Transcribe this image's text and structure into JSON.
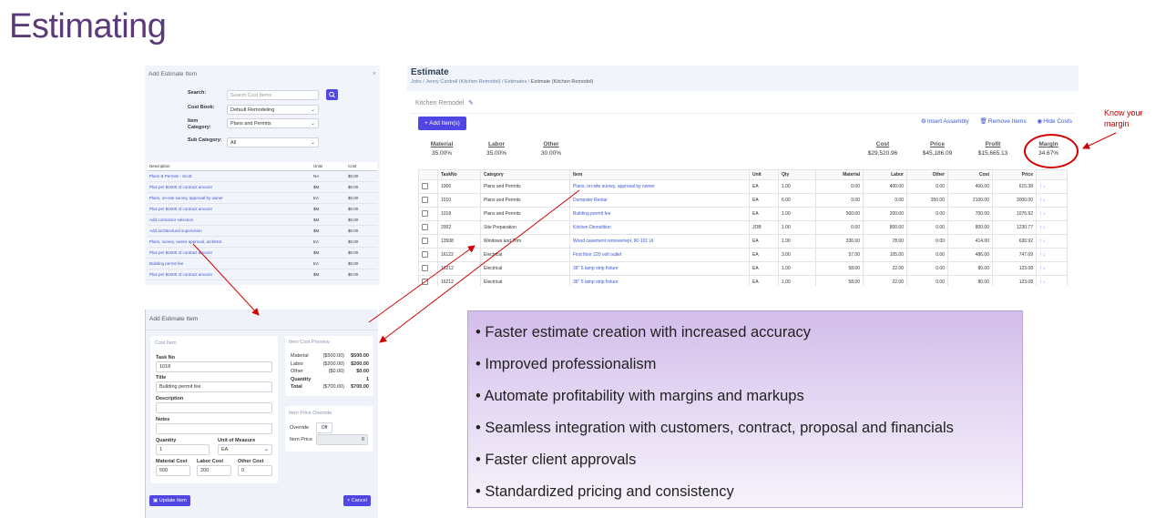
{
  "slide": {
    "title": "Estimating"
  },
  "add_item_search": {
    "title": "Add Estimate Item",
    "close": "×",
    "search_label": "Search:",
    "search_placeholder": "Search Cost Items",
    "cost_book_label": "Cost Book:",
    "cost_book_value": "Default Remodeling",
    "item_category_label": "Item Category:",
    "item_category_value": "Plans and Permits",
    "sub_category_label": "Sub Category:",
    "sub_category_value": "All",
    "columns": [
      "Description",
      "Units",
      "Cost"
    ],
    "rows": [
      [
        "Plans & Permits - Scott",
        "NA",
        "$0.00"
      ],
      [
        "Plus per $1000 of contract amount",
        "$M",
        "$0.00"
      ],
      [
        "Plans, on-site survey, approval by owner",
        "EA",
        "$0.00"
      ],
      [
        "Plus per $1000 of contract amount",
        "$M",
        "$0.00"
      ],
      [
        "Add contractor selection",
        "$M",
        "$0.00"
      ],
      [
        "Add architectural supervision",
        "$M",
        "$0.00"
      ],
      [
        "Plans, survey, owner approval, architect",
        "EA",
        "$0.00"
      ],
      [
        "Plus per $1000 of contract amount",
        "$M",
        "$0.00"
      ],
      [
        "Building permit fee",
        "EA",
        "$0.00"
      ],
      [
        "Plus per $1000 of contract amount",
        "$M",
        "$0.00"
      ]
    ]
  },
  "estimate": {
    "title": "Estimate",
    "breadcrumb": [
      "Jobs",
      "Jenny Cantrell (Kitchen Remodel)",
      "Estimates"
    ],
    "breadcrumb_current": "Estimate (Kitchen Remodel)",
    "job_name": "Kitchen Remodel",
    "add_button": "+ Add Item(s)",
    "toolbar": [
      "Insert Assembly",
      "Remove Items",
      "Hide Costs"
    ],
    "summary_left": [
      {
        "label": "Material",
        "value": "35.00%"
      },
      {
        "label": "Labor",
        "value": "35.00%"
      },
      {
        "label": "Other",
        "value": "30.00%"
      }
    ],
    "summary_right": [
      {
        "label": "Cost",
        "value": "$29,520.96"
      },
      {
        "label": "Price",
        "value": "$45,186.09"
      },
      {
        "label": "Profit",
        "value": "$15,665.13"
      },
      {
        "label": "Margin",
        "value": "34.67%"
      }
    ],
    "columns": [
      "TaskNo",
      "Category",
      "Item",
      "Unit",
      "Qty",
      "Material",
      "Labor",
      "Other",
      "Cost",
      "Price"
    ],
    "rows": [
      [
        "1006",
        "Plans and Permits",
        "Plans, on-site survey, approval by owner",
        "EA",
        "1.00",
        "0.00",
        "400.00",
        "0.00",
        "400.00",
        "615.38"
      ],
      [
        "1010",
        "Plans and Permits",
        "Dumpster Rental",
        "EA",
        "6.00",
        "0.00",
        "0.00",
        "350.00",
        "2100.00",
        "3000.00"
      ],
      [
        "1018",
        "Plans and Permits",
        "Building permit fee",
        "EA",
        "1.00",
        "500.00",
        "200.00",
        "0.00",
        "700.00",
        "1076.92"
      ],
      [
        "2002",
        "Site Preparation",
        "Kitchen Demolition",
        "JOB",
        "1.00",
        "0.00",
        "800.00",
        "0.00",
        "800.00",
        "1230.77"
      ],
      [
        "13508",
        "Windows and Trim",
        "Wood casement remove/repl, 90-101 UI",
        "EA",
        "1.00",
        "336.00",
        "78.00",
        "0.00",
        "414.00",
        "636.92"
      ],
      [
        "16122",
        "Electrical",
        "First floor 220 volt outlet",
        "EA",
        "3.00",
        "57.00",
        "105.00",
        "0.00",
        "486.00",
        "747.69"
      ],
      [
        "16212",
        "Electrical",
        "36\" 5 lamp strip fixture",
        "EA",
        "1.00",
        "58.00",
        "22.00",
        "0.00",
        "80.00",
        "123.08"
      ],
      [
        "16212",
        "Electrical",
        "36\" 5 lamp strip fixture",
        "EA",
        "1.00",
        "58.00",
        "22.00",
        "0.00",
        "80.00",
        "123.08"
      ]
    ],
    "row_arrows": "↑ ↓"
  },
  "item_form": {
    "title": "Add Estimate Item",
    "card_title": "Cost Item",
    "task_no_label": "Task No",
    "task_no_value": "1018",
    "title_label": "Title",
    "title_value": "Building permit fee",
    "description_label": "Description",
    "notes_label": "Notes",
    "quantity_label": "Quantity",
    "quantity_value": "1",
    "uom_label": "Unit of Measure",
    "uom_value": "EA",
    "material_cost_label": "Material Cost",
    "material_cost_value": "500",
    "labor_cost_label": "Labor Cost",
    "labor_cost_value": "200",
    "other_cost_label": "Other Cost",
    "other_cost_value": "0",
    "preview_title": "Item Cost Preview",
    "preview_rows": [
      [
        "Material",
        "($500.00)",
        "$500.00"
      ],
      [
        "Labor",
        "($200.00)",
        "$200.00"
      ],
      [
        "Other",
        "($0.00)",
        "$0.00"
      ],
      [
        "Quantity",
        "",
        "1"
      ],
      [
        "Total",
        "($700.00)",
        "$700.00"
      ]
    ],
    "override_title": "Item Price Override",
    "override_label": "Override",
    "override_value": "Off",
    "item_price_label": "Item Price",
    "item_price_value": "0",
    "update_button": "Update Item",
    "cancel_button": "× Cancel"
  },
  "bullets": [
    "• Faster estimate creation with increased accuracy",
    "• Improved professionalism",
    "• Automate profitability with margins and markups",
    "• Seamless integration with customers, contract, proposal and financials",
    "• Faster client approvals",
    "• Standardized pricing and consistency"
  ],
  "callout": {
    "line1": "Know your",
    "line2": "margin"
  },
  "colors": {
    "accent": "#5046e4",
    "title": "#5b3a78",
    "annotation": "#d40000"
  }
}
